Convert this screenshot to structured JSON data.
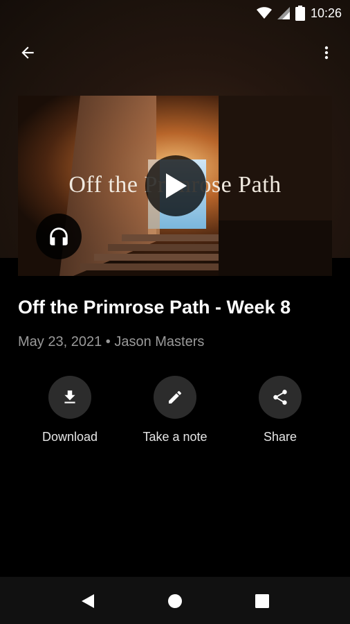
{
  "status_bar": {
    "time": "10:26"
  },
  "artwork": {
    "title_text": "Off the Primrose Path"
  },
  "sermon": {
    "title": "Off the Primrose Path - Week 8",
    "date": "May 23, 2021",
    "separator": "•",
    "speaker": "Jason Masters"
  },
  "actions": [
    {
      "label": "Download",
      "icon": "download-icon"
    },
    {
      "label": "Take a note",
      "icon": "pencil-icon"
    },
    {
      "label": "Share",
      "icon": "share-icon"
    }
  ],
  "colors": {
    "background": "#000000",
    "meta_text": "#9a9a9a",
    "action_circle": "#2c2c2c"
  }
}
